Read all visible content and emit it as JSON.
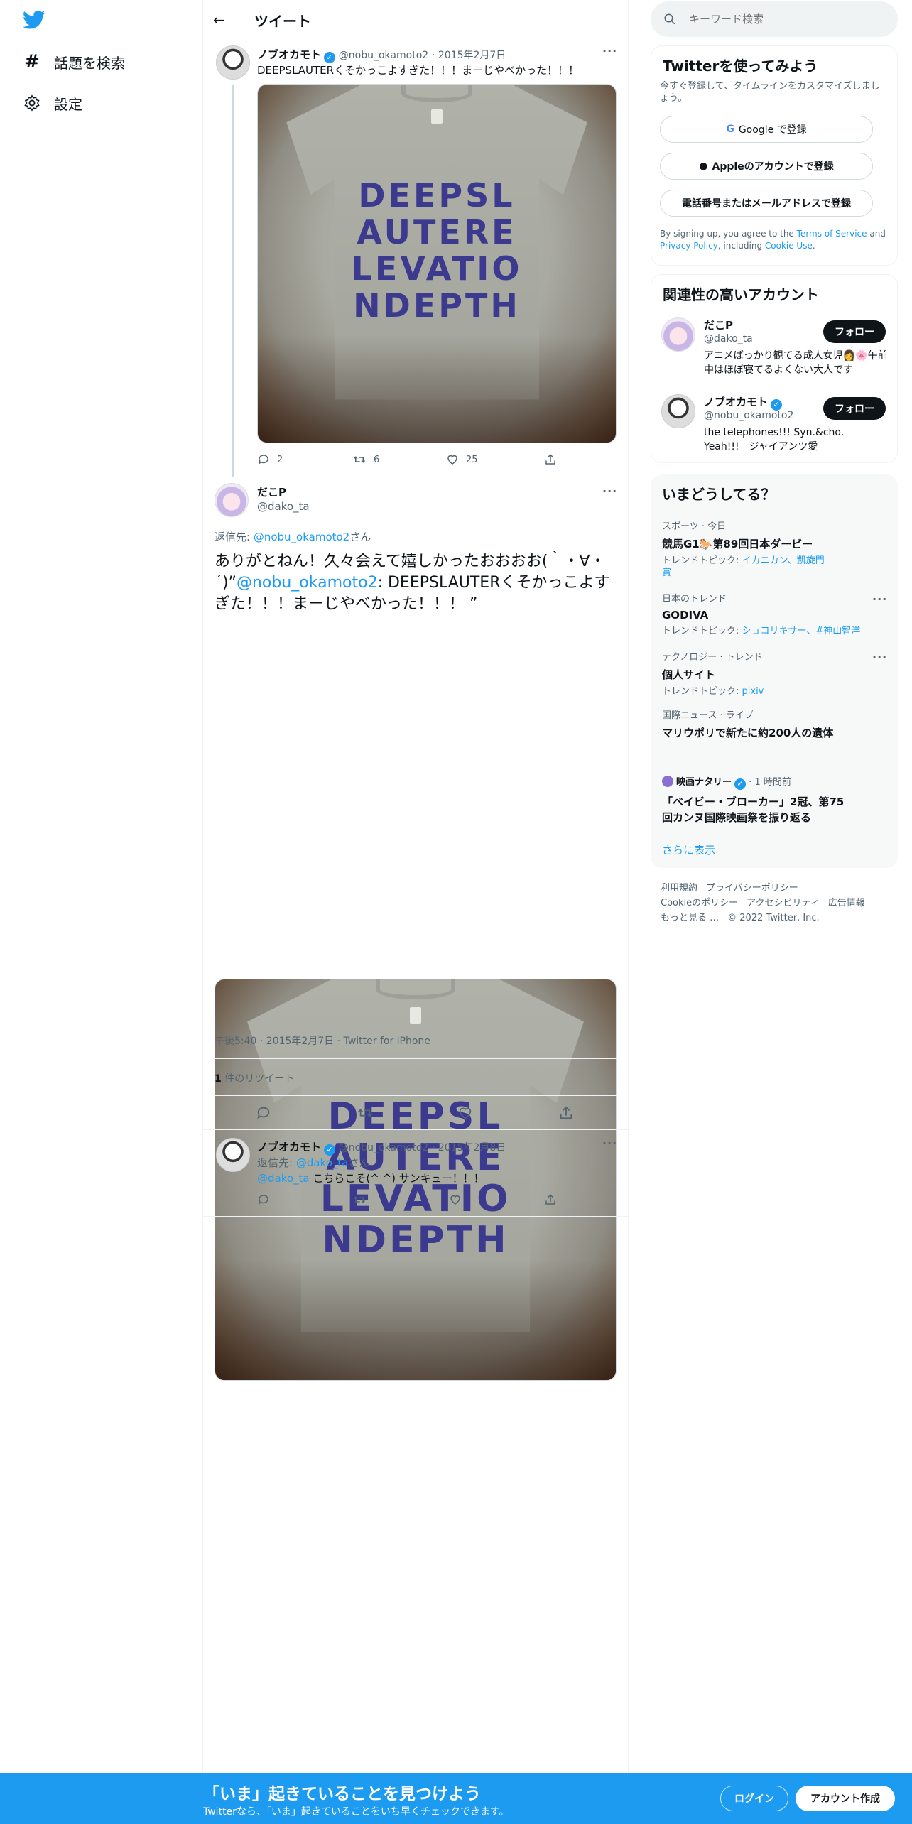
{
  "nav": {
    "explore": "話題を検索",
    "settings": "設定"
  },
  "header": {
    "title": "ツイート"
  },
  "tweet1": {
    "name": "ノブオカモト",
    "handle": "@nobu_okamoto2",
    "date": "· 2015年2月7日",
    "text": "DEEPSLAUTERくそかっこよすぎた！！！まーじやべかった！！！",
    "replies": "2",
    "retweets": "6",
    "likes": "25"
  },
  "shirt_print": {
    "line1": "DEEPSL",
    "line2": "AUTERE",
    "line3": "LEVATIO",
    "line4": "NDEPTH"
  },
  "main": {
    "name": "だこP",
    "handle": "@dako_ta",
    "reply_prefix": "返信先: ",
    "reply_to": "@nobu_okamoto2",
    "reply_suffix": "さん",
    "text_a": "ありがとねん！久々会えて嬉しかったおおおお(｀・∀・´)”",
    "mention": "@nobu_okamoto2",
    "text_b": ": DEEPSLAUTERくそかっこよすぎた！！！まーじやべかった！！！ ”",
    "meta": "午後5:40 · 2015年2月7日 · Twitter for iPhone",
    "rt_count": "1",
    "rt_label": " 件のリツイート"
  },
  "tweet3": {
    "name": "ノブオカモト",
    "handle": "@nobu_okamoto2",
    "date": "· 2015年2月8日",
    "reply_prefix": "返信先: ",
    "reply_to": "@dako_ta",
    "reply_suffix": "さん",
    "mention": "@dako_ta",
    "text": " こちらこそ(^ ^) サンキュー！！！"
  },
  "search": {
    "placeholder": "キーワード検索"
  },
  "signup": {
    "title": "Twitterを使ってみよう",
    "desc": "今すぐ登録して、タイムラインをカスタマイズしましょう。",
    "google": "Google で登録",
    "apple": "Appleのアカウントで登録",
    "phone": "電話番号またはメールアドレスで登録",
    "legal_a": "By signing up, you agree to the ",
    "tos": "Terms of Service",
    "legal_b": " and ",
    "privacy": "Privacy Policy",
    "legal_c": ", including ",
    "cookie": "Cookie Use",
    "legal_d": "."
  },
  "related": {
    "title": "関連性の高いアカウント",
    "follow": "フォロー",
    "accounts": [
      {
        "name": "だこP",
        "handle": "@dako_ta",
        "bio": "アニメばっかり観てる成人女児👩🌸午前中はほぼ寝てるよくない大人です"
      },
      {
        "name": "ノブオカモト",
        "handle": "@nobu_okamoto2",
        "bio": "the telephones!!! Syn.&cho. Yeah!!!　ジャイアンツ愛"
      }
    ]
  },
  "trends": {
    "title": "いまどうしてる？",
    "items": [
      {
        "cat": "スポーツ · 今日",
        "title": "競馬G1🐎第89回日本ダービー",
        "sub_label": "トレンドトピック: ",
        "sub_links": "イカニカン、凱旋門賞"
      },
      {
        "cat": "日本のトレンド",
        "title": "GODIVA",
        "sub_label": "トレンドトピック: ",
        "sub_links": "ショコリキサー、#神山智洋"
      },
      {
        "cat": "テクノロジー · トレンド",
        "title": "個人サイト",
        "sub_label": "トレンドトピック: ",
        "sub_links": "pixiv"
      },
      {
        "cat": "国際ニュース · ライブ",
        "title": "マリウポリで新たに約200人の遺体",
        "sub_label": "",
        "sub_links": ""
      }
    ],
    "news_source": "映画ナタリー",
    "news_time": "· 1 時間前",
    "news_title": "「ベイビー・ブローカー」2冠、第75回カンヌ国際映画祭を振り返る",
    "more": "さらに表示"
  },
  "footer": {
    "terms": "利用規約",
    "privacy": "プライバシーポリシー",
    "cookie": "Cookieのポリシー",
    "access": "アクセシビリティ",
    "ads": "広告情報",
    "more": "もっと見る …",
    "copy": "© 2022 Twitter, Inc."
  },
  "banner": {
    "title": "「いま」起きていることを見つけよう",
    "sub": "Twitterなら、「いま」起きていることをいち早くチェックできます。",
    "login": "ログイン",
    "signup": "アカウント作成"
  }
}
